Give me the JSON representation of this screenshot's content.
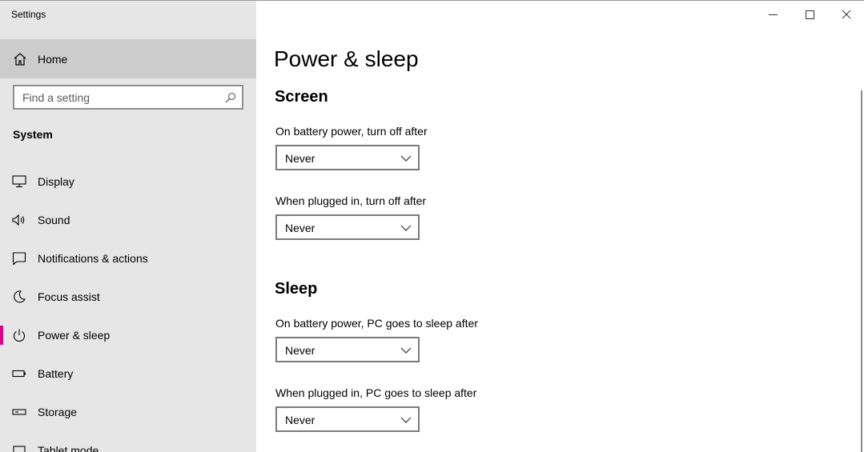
{
  "window": {
    "title": "Settings",
    "controls": [
      "minimize",
      "maximize",
      "close"
    ]
  },
  "sidebar": {
    "home_label": "Home",
    "search": {
      "placeholder": "Find a setting"
    },
    "section_label": "System",
    "items": [
      {
        "label": "Display",
        "icon": "display-icon"
      },
      {
        "label": "Sound",
        "icon": "speaker-icon"
      },
      {
        "label": "Notifications & actions",
        "icon": "notification-icon"
      },
      {
        "label": "Focus assist",
        "icon": "moon-icon"
      },
      {
        "label": "Power & sleep",
        "icon": "power-icon",
        "selected": true
      },
      {
        "label": "Battery",
        "icon": "battery-icon"
      },
      {
        "label": "Storage",
        "icon": "storage-icon"
      },
      {
        "label": "Tablet mode",
        "icon": "tablet-icon"
      }
    ],
    "accent_color": "#e3008c"
  },
  "main": {
    "page_title": "Power & sleep",
    "screen": {
      "title": "Screen",
      "battery_label": "On battery power, turn off after",
      "battery_value": "Never",
      "plugged_label": "When plugged in, turn off after",
      "plugged_value": "Never"
    },
    "sleep": {
      "title": "Sleep",
      "battery_label": "On battery power, PC goes to sleep after",
      "battery_value": "Never",
      "plugged_label": "When plugged in, PC goes to sleep after",
      "plugged_value": "Never"
    }
  }
}
